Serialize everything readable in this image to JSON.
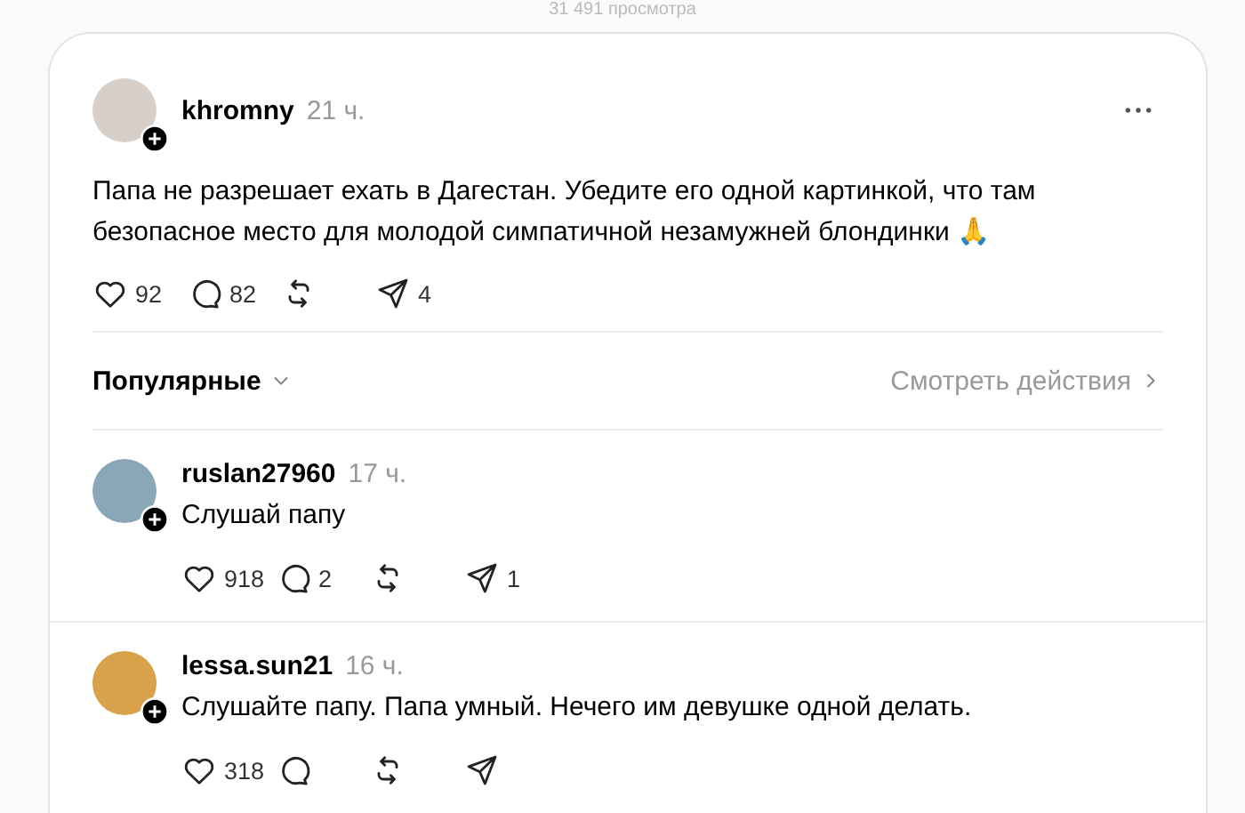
{
  "views": "31 491 просмотра",
  "post": {
    "author": "khromny",
    "time": "21 ч.",
    "text": "Папа не разрешает ехать в Дагестан. Убедите его одной картинкой, что там безопасное место для молодой симпатичной незамужней блондинки 🙏",
    "actions": [
      {
        "kind": "like",
        "count": "92"
      },
      {
        "kind": "reply",
        "count": "82"
      },
      {
        "kind": "repost"
      },
      {
        "kind": "share",
        "count": "4"
      }
    ]
  },
  "sort": {
    "label": "Популярные",
    "activity": "Смотреть действия"
  },
  "comments": [
    {
      "author": "ruslan27960",
      "time": "17 ч.",
      "text": "Слушай папу",
      "actions": [
        {
          "kind": "like",
          "count": "918"
        },
        {
          "kind": "reply",
          "count": "2"
        },
        {
          "kind": "repost"
        },
        {
          "kind": "share",
          "count": "1"
        }
      ]
    },
    {
      "author": "lessa.sun21",
      "time": "16 ч.",
      "text": "Слушайте папу. Папа умный. Нечего им девушке одной делать.",
      "actions": [
        {
          "kind": "like",
          "count": "318"
        },
        {
          "kind": "reply"
        },
        {
          "kind": "repost"
        },
        {
          "kind": "share"
        }
      ]
    }
  ]
}
